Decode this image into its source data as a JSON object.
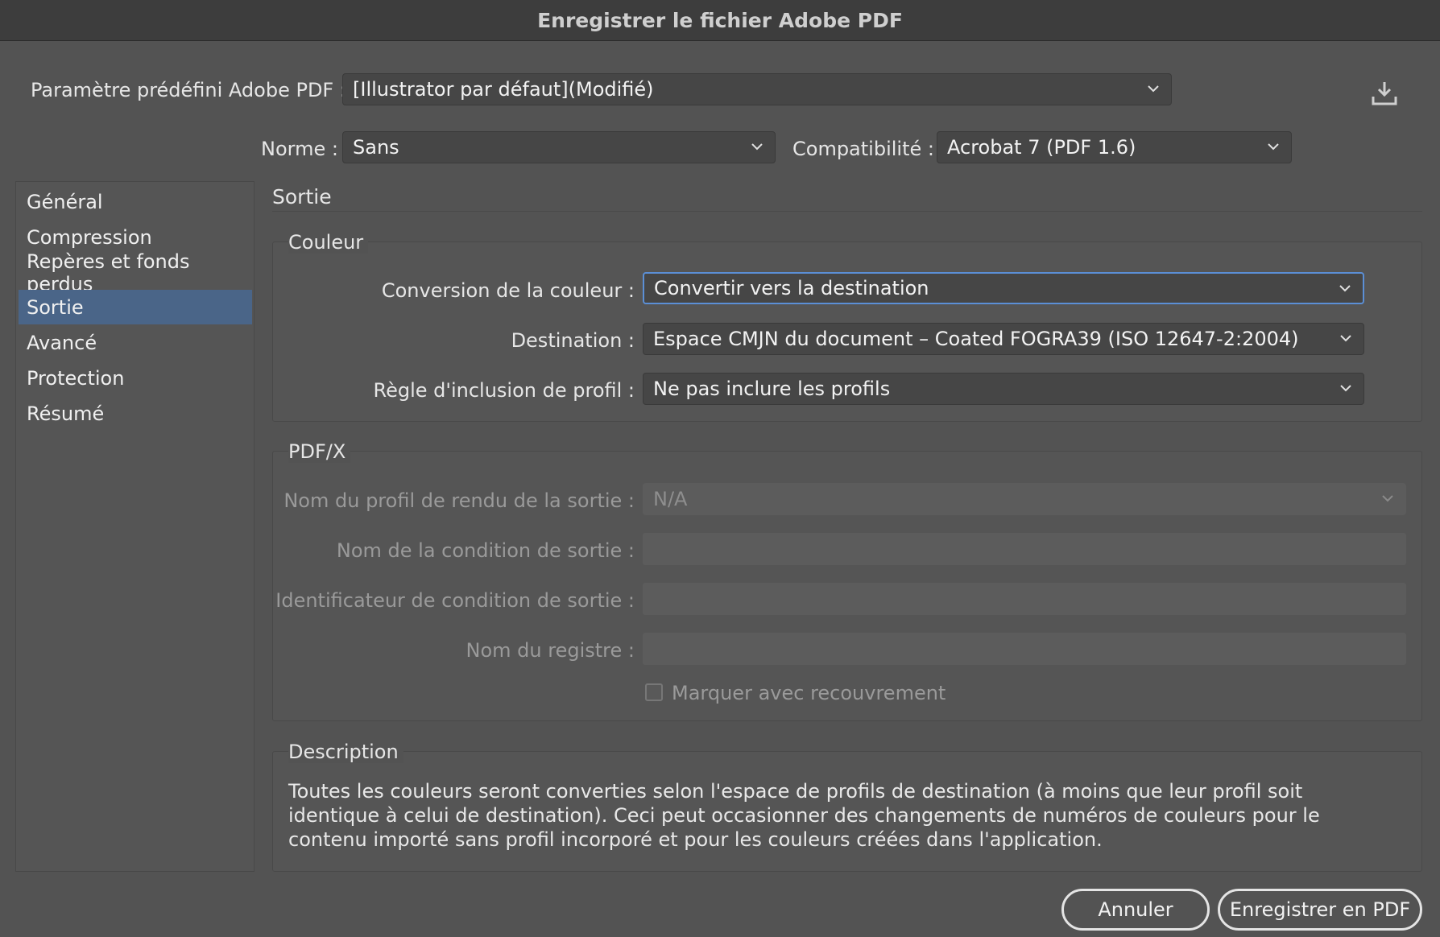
{
  "window": {
    "title": "Enregistrer le fichier Adobe PDF"
  },
  "preset": {
    "label": "Paramètre prédéfini Adobe PDF :",
    "value": "[Illustrator par défaut](Modifié)"
  },
  "standard": {
    "label": "Norme :",
    "value": "Sans"
  },
  "compatibility": {
    "label": "Compatibilité :",
    "value": "Acrobat 7 (PDF 1.6)"
  },
  "sidebar": {
    "items": [
      {
        "label": "Général",
        "active": false
      },
      {
        "label": "Compression",
        "active": false
      },
      {
        "label": "Repères et fonds perdus",
        "active": false
      },
      {
        "label": "Sortie",
        "active": true
      },
      {
        "label": "Avancé",
        "active": false
      },
      {
        "label": "Protection",
        "active": false
      },
      {
        "label": "Résumé",
        "active": false
      }
    ]
  },
  "section": {
    "title": "Sortie"
  },
  "color": {
    "title": "Couleur",
    "conversion": {
      "label": "Conversion de la couleur :",
      "value": "Convertir vers la destination"
    },
    "destination": {
      "label": "Destination :",
      "value": "Espace CMJN du document – Coated FOGRA39 (ISO 12647-2:2004)"
    },
    "profile_rule": {
      "label": "Règle d'inclusion de profil :",
      "value": "Ne pas inclure les profils"
    }
  },
  "pdfx": {
    "title": "PDF/X",
    "render_profile": {
      "label": "Nom du profil de rendu de la sortie :",
      "value": "N/A"
    },
    "condition_name": {
      "label": "Nom de la condition de sortie :",
      "value": ""
    },
    "condition_id": {
      "label": "Identificateur de condition de sortie :",
      "value": ""
    },
    "registry": {
      "label": "Nom du registre :",
      "value": ""
    },
    "trapped": {
      "label": "Marquer avec recouvrement",
      "checked": false
    }
  },
  "description": {
    "title": "Description",
    "text": "Toutes les couleurs seront converties selon l'espace de profils de destination (à moins que leur profil soit identique à celui de destination). Ceci peut occasionner des changements de numéros de couleurs pour le contenu importé sans profil incorporé et pour les couleurs créées dans l'application."
  },
  "buttons": {
    "cancel": "Annuler",
    "save": "Enregistrer en PDF"
  },
  "icons": {
    "save_preset": "download-icon",
    "dropdown": "chevron-down-icon"
  },
  "colors": {
    "accent": "#4a6588",
    "focus": "#5b8fd6",
    "background": "#535353"
  }
}
